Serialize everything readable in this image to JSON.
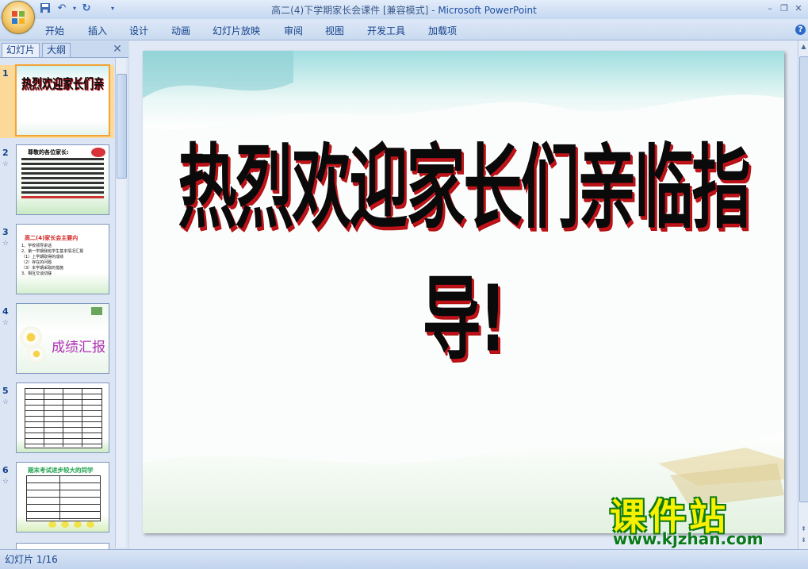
{
  "window": {
    "title_doc": "高二(4)下学期家长会课件 [兼容模式] - ",
    "title_app": "Microsoft PowerPoint",
    "minimize": "–",
    "restore": "❐",
    "close": "✕"
  },
  "ribbon": {
    "tabs": [
      "开始",
      "插入",
      "设计",
      "动画",
      "幻灯片放映",
      "审阅",
      "视图",
      "开发工具",
      "加载项"
    ],
    "help": "?"
  },
  "panel": {
    "tab_slides": "幻灯片",
    "tab_outline": "大纲",
    "close": "✕"
  },
  "thumbnails": [
    {
      "num": "1",
      "title": "热烈欢迎家长们亲临指导!",
      "selected": true
    },
    {
      "num": "2",
      "title": "尊敬的各位家长:",
      "selected": false
    },
    {
      "num": "3",
      "title": "高二(4)家长会主要内",
      "items": [
        "1、学校领导讲话",
        "2、第一学期我班学生基本情况汇报",
        "（1）上学期取得的成绩",
        "（2）存在的问题",
        "（3）本学期采取的措施",
        "3、相互交谈切磋"
      ],
      "selected": false
    },
    {
      "num": "4",
      "title": "成绩汇报",
      "selected": false
    },
    {
      "num": "5",
      "title": "",
      "selected": false
    },
    {
      "num": "6",
      "title": "期末考试进步较大的同学",
      "selected": false
    }
  ],
  "slide": {
    "title": "热烈欢迎家长们亲临指导!"
  },
  "watermark": {
    "brand": "课件站",
    "url": "www.kjzhan.com"
  },
  "status": {
    "slide_position": "幻灯片 1/16"
  },
  "colors": {
    "ribbon": "#c9daf0",
    "selected_thumb": "#f2a434",
    "title_outline": "#c0121a"
  }
}
